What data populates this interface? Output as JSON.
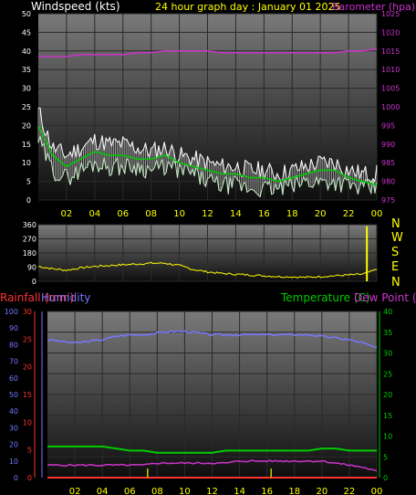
{
  "header": {
    "left_label": "Windspeed (kts)",
    "title": "24 hour graph day :  January 01 2025",
    "right_label": "Barometer (hpa)"
  },
  "compass_labels": [
    "N",
    "W",
    "S",
    "E",
    "N"
  ],
  "middle_titles": {
    "rainfall": "Rainfall (mm)",
    "humidity": "Humidity",
    "temperature": "Temperature (C)",
    "dewpoint": "Dew Point (C)"
  },
  "colors": {
    "wind_gust": "#ffffff",
    "wind_avg": "#c8f0c8",
    "wind_trend": "#00cc00",
    "barometer": "#cc33cc",
    "direction": "#ffff00",
    "humidity": "#7777ff",
    "temperature": "#00cc00",
    "dewpoint": "#cc33cc",
    "rainfall": "#ff3333",
    "rain_bars": "#cccc00"
  },
  "chart_data": [
    {
      "type": "line",
      "title": "24 hour graph day :  January 01 2025",
      "x": [
        0,
        1,
        2,
        3,
        4,
        5,
        6,
        7,
        8,
        9,
        10,
        11,
        12,
        13,
        14,
        15,
        16,
        17,
        18,
        19,
        20,
        21,
        22,
        23,
        24
      ],
      "x_tick_labels": [
        "02",
        "04",
        "06",
        "08",
        "10",
        "12",
        "14",
        "16",
        "18",
        "20",
        "22",
        "00"
      ],
      "series": [
        {
          "name": "Windspeed (kts)",
          "axis": "left",
          "values": [
            24,
            14,
            12,
            14,
            16,
            15,
            15,
            14,
            13,
            14,
            12,
            11,
            10,
            9,
            9,
            8,
            8,
            7,
            8,
            9,
            10,
            10,
            8,
            7,
            7
          ]
        },
        {
          "name": "Windspeed (kts)",
          "axis": "left",
          "values": [
            20,
            12,
            9,
            11,
            13,
            12,
            12,
            11,
            11,
            12,
            10,
            9,
            8,
            7,
            7,
            6,
            6,
            5,
            6,
            7,
            8,
            8,
            6,
            5,
            4
          ]
        },
        {
          "name": "Windspeed (kts)",
          "axis": "left",
          "values": [
            16,
            8,
            6,
            8,
            10,
            9,
            9,
            9,
            8,
            9,
            8,
            7,
            5,
            4,
            4,
            3,
            3,
            3,
            4,
            5,
            5,
            5,
            4,
            3,
            3
          ]
        },
        {
          "name": "Barometer (hpa)",
          "axis": "right",
          "values": [
            1013.5,
            1013.5,
            1013.5,
            1014,
            1014,
            1014,
            1014,
            1014.5,
            1014.5,
            1015,
            1015,
            1015,
            1015,
            1014.5,
            1014.5,
            1014.5,
            1014.5,
            1014.5,
            1014.5,
            1014.5,
            1014.5,
            1014.5,
            1015,
            1015,
            1015.5
          ]
        }
      ],
      "ylim": [
        0,
        50
      ],
      "y_ticks": [
        0,
        5,
        10,
        15,
        20,
        25,
        30,
        35,
        40,
        45,
        50
      ],
      "y2lim": [
        975,
        1025
      ],
      "y2_ticks": [
        975,
        980,
        985,
        990,
        995,
        1000,
        1005,
        1010,
        1015,
        1020,
        1025
      ],
      "grid": true
    },
    {
      "type": "line",
      "x": [
        0,
        1,
        2,
        3,
        4,
        5,
        6,
        7,
        8,
        9,
        10,
        11,
        12,
        13,
        14,
        15,
        16,
        17,
        18,
        19,
        20,
        21,
        22,
        23,
        24
      ],
      "series": [
        {
          "name": "Wind direction",
          "values": [
            95,
            80,
            70,
            85,
            95,
            100,
            105,
            110,
            115,
            115,
            100,
            75,
            60,
            50,
            45,
            40,
            35,
            30,
            28,
            25,
            30,
            35,
            40,
            45,
            75
          ]
        }
      ],
      "ylim": [
        0,
        360
      ],
      "y_ticks": [
        0,
        90,
        180,
        270,
        360
      ],
      "y_tick_labels": [
        "0",
        "90",
        "180",
        "270",
        "360"
      ],
      "grid": true
    },
    {
      "type": "line",
      "x": [
        0,
        1,
        2,
        3,
        4,
        5,
        6,
        7,
        8,
        9,
        10,
        11,
        12,
        13,
        14,
        15,
        16,
        17,
        18,
        19,
        20,
        21,
        22,
        23,
        24
      ],
      "x_tick_labels": [
        "02",
        "04",
        "06",
        "08",
        "10",
        "12",
        "14",
        "16",
        "18",
        "20",
        "22",
        "00"
      ],
      "series": [
        {
          "name": "Humidity",
          "axis": "humidity",
          "values": [
            83,
            82,
            81,
            82,
            83,
            85,
            86,
            86,
            87,
            88,
            88,
            87,
            86,
            86,
            86,
            86,
            86,
            86,
            86,
            86,
            85,
            84,
            83,
            81,
            78
          ]
        },
        {
          "name": "Temperature (C)",
          "axis": "right",
          "values": [
            7.5,
            7.5,
            7.5,
            7.5,
            7.5,
            7,
            6.5,
            6.5,
            6,
            6,
            6,
            6,
            6,
            6.5,
            6.5,
            6.5,
            6.5,
            6.5,
            6.5,
            6.5,
            7,
            7,
            6.5,
            6.5,
            6.5
          ]
        },
        {
          "name": "Dew Point (C)",
          "axis": "right",
          "values": [
            3,
            3,
            3,
            3,
            3,
            3,
            3,
            3,
            3.5,
            3.5,
            3.5,
            3.5,
            3.5,
            3.5,
            4,
            4,
            4,
            4,
            4,
            4,
            4,
            3.5,
            3,
            2.5,
            1.5
          ]
        },
        {
          "name": "Rainfall (mm)",
          "axis": "left",
          "values": [
            0,
            0,
            0,
            0,
            0,
            0,
            0,
            0,
            0,
            0,
            0,
            0,
            0,
            0,
            0,
            0,
            0,
            0,
            0,
            0,
            0,
            0,
            0,
            0,
            0
          ]
        }
      ],
      "ylim_rain": [
        0,
        30
      ],
      "y_ticks_rain": [
        0,
        5,
        10,
        15,
        20,
        25,
        30
      ],
      "ylim_humidity": [
        0,
        100
      ],
      "y_ticks_humidity": [
        0,
        10,
        20,
        30,
        40,
        50,
        60,
        70,
        80,
        90,
        100
      ],
      "ylim": [
        0,
        40
      ],
      "y_ticks": [
        0,
        5,
        10,
        15,
        20,
        25,
        30,
        35,
        40
      ],
      "grid": true
    }
  ]
}
